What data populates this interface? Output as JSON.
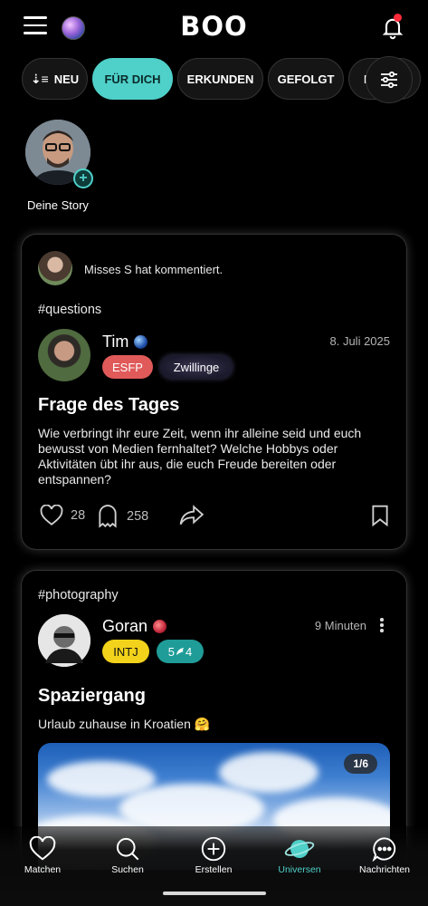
{
  "header": {
    "logo": "BOO"
  },
  "chips": [
    {
      "label": "NEU",
      "glyph": "↓☰"
    },
    {
      "label": "FÜR DICH"
    },
    {
      "label": "ERKUNDEN"
    },
    {
      "label": "GEFOLGT"
    },
    {
      "label": "FI"
    }
  ],
  "story": {
    "label": "Deine Story",
    "plus": "+"
  },
  "posts": [
    {
      "comment": "Misses S hat kommentiert.",
      "hashtag": "#questions",
      "author": "Tim",
      "date": "8. Juli 2025",
      "tags": [
        "ESFP",
        "Zwillinge"
      ],
      "title": "Frage des Tages",
      "body": "Wie verbringt ihr eure Zeit, wenn ihr alleine seid und euch bewusst von Medien fernhaltet? Welche Hobbys oder Aktivitäten übt ihr aus, die euch Freude bereiten oder entspannen?",
      "likes": "28",
      "comments": "258"
    },
    {
      "hashtag": "#photography",
      "author": "Goran",
      "date": "9 Minuten",
      "tags": [
        "INTJ",
        "5w4"
      ],
      "tag2_display": "5",
      "tag2_suffix": "4",
      "title": "Spaziergang",
      "body": "Urlaub zuhause in Kroatien 🤗",
      "photo_counter": "1/6"
    }
  ],
  "nav": [
    {
      "label": "Matchen",
      "icon": "heart-icon"
    },
    {
      "label": "Suchen",
      "icon": "search-icon"
    },
    {
      "label": "Erstellen",
      "icon": "plus-circle-icon"
    },
    {
      "label": "Universen",
      "icon": "planet-icon"
    },
    {
      "label": "Nachrichten",
      "icon": "chat-bubble-icon"
    }
  ],
  "colors": {
    "accent": "#4fd0c9",
    "esfp": "#e05a5a",
    "intj": "#f2d21b",
    "enneagram": "#1f9c98",
    "notification": "#ff2b3b"
  }
}
